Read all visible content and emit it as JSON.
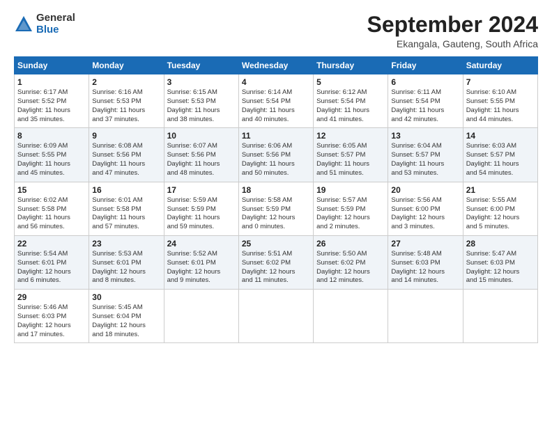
{
  "header": {
    "logo_general": "General",
    "logo_blue": "Blue",
    "month": "September 2024",
    "location": "Ekangala, Gauteng, South Africa"
  },
  "days_of_week": [
    "Sunday",
    "Monday",
    "Tuesday",
    "Wednesday",
    "Thursday",
    "Friday",
    "Saturday"
  ],
  "weeks": [
    [
      {
        "day": "1",
        "info": "Sunrise: 6:17 AM\nSunset: 5:52 PM\nDaylight: 11 hours\nand 35 minutes."
      },
      {
        "day": "2",
        "info": "Sunrise: 6:16 AM\nSunset: 5:53 PM\nDaylight: 11 hours\nand 37 minutes."
      },
      {
        "day": "3",
        "info": "Sunrise: 6:15 AM\nSunset: 5:53 PM\nDaylight: 11 hours\nand 38 minutes."
      },
      {
        "day": "4",
        "info": "Sunrise: 6:14 AM\nSunset: 5:54 PM\nDaylight: 11 hours\nand 40 minutes."
      },
      {
        "day": "5",
        "info": "Sunrise: 6:12 AM\nSunset: 5:54 PM\nDaylight: 11 hours\nand 41 minutes."
      },
      {
        "day": "6",
        "info": "Sunrise: 6:11 AM\nSunset: 5:54 PM\nDaylight: 11 hours\nand 42 minutes."
      },
      {
        "day": "7",
        "info": "Sunrise: 6:10 AM\nSunset: 5:55 PM\nDaylight: 11 hours\nand 44 minutes."
      }
    ],
    [
      {
        "day": "8",
        "info": "Sunrise: 6:09 AM\nSunset: 5:55 PM\nDaylight: 11 hours\nand 45 minutes."
      },
      {
        "day": "9",
        "info": "Sunrise: 6:08 AM\nSunset: 5:56 PM\nDaylight: 11 hours\nand 47 minutes."
      },
      {
        "day": "10",
        "info": "Sunrise: 6:07 AM\nSunset: 5:56 PM\nDaylight: 11 hours\nand 48 minutes."
      },
      {
        "day": "11",
        "info": "Sunrise: 6:06 AM\nSunset: 5:56 PM\nDaylight: 11 hours\nand 50 minutes."
      },
      {
        "day": "12",
        "info": "Sunrise: 6:05 AM\nSunset: 5:57 PM\nDaylight: 11 hours\nand 51 minutes."
      },
      {
        "day": "13",
        "info": "Sunrise: 6:04 AM\nSunset: 5:57 PM\nDaylight: 11 hours\nand 53 minutes."
      },
      {
        "day": "14",
        "info": "Sunrise: 6:03 AM\nSunset: 5:57 PM\nDaylight: 11 hours\nand 54 minutes."
      }
    ],
    [
      {
        "day": "15",
        "info": "Sunrise: 6:02 AM\nSunset: 5:58 PM\nDaylight: 11 hours\nand 56 minutes."
      },
      {
        "day": "16",
        "info": "Sunrise: 6:01 AM\nSunset: 5:58 PM\nDaylight: 11 hours\nand 57 minutes."
      },
      {
        "day": "17",
        "info": "Sunrise: 5:59 AM\nSunset: 5:59 PM\nDaylight: 11 hours\nand 59 minutes."
      },
      {
        "day": "18",
        "info": "Sunrise: 5:58 AM\nSunset: 5:59 PM\nDaylight: 12 hours\nand 0 minutes."
      },
      {
        "day": "19",
        "info": "Sunrise: 5:57 AM\nSunset: 5:59 PM\nDaylight: 12 hours\nand 2 minutes."
      },
      {
        "day": "20",
        "info": "Sunrise: 5:56 AM\nSunset: 6:00 PM\nDaylight: 12 hours\nand 3 minutes."
      },
      {
        "day": "21",
        "info": "Sunrise: 5:55 AM\nSunset: 6:00 PM\nDaylight: 12 hours\nand 5 minutes."
      }
    ],
    [
      {
        "day": "22",
        "info": "Sunrise: 5:54 AM\nSunset: 6:01 PM\nDaylight: 12 hours\nand 6 minutes."
      },
      {
        "day": "23",
        "info": "Sunrise: 5:53 AM\nSunset: 6:01 PM\nDaylight: 12 hours\nand 8 minutes."
      },
      {
        "day": "24",
        "info": "Sunrise: 5:52 AM\nSunset: 6:01 PM\nDaylight: 12 hours\nand 9 minutes."
      },
      {
        "day": "25",
        "info": "Sunrise: 5:51 AM\nSunset: 6:02 PM\nDaylight: 12 hours\nand 11 minutes."
      },
      {
        "day": "26",
        "info": "Sunrise: 5:50 AM\nSunset: 6:02 PM\nDaylight: 12 hours\nand 12 minutes."
      },
      {
        "day": "27",
        "info": "Sunrise: 5:48 AM\nSunset: 6:03 PM\nDaylight: 12 hours\nand 14 minutes."
      },
      {
        "day": "28",
        "info": "Sunrise: 5:47 AM\nSunset: 6:03 PM\nDaylight: 12 hours\nand 15 minutes."
      }
    ],
    [
      {
        "day": "29",
        "info": "Sunrise: 5:46 AM\nSunset: 6:03 PM\nDaylight: 12 hours\nand 17 minutes."
      },
      {
        "day": "30",
        "info": "Sunrise: 5:45 AM\nSunset: 6:04 PM\nDaylight: 12 hours\nand 18 minutes."
      },
      {
        "day": "",
        "info": ""
      },
      {
        "day": "",
        "info": ""
      },
      {
        "day": "",
        "info": ""
      },
      {
        "day": "",
        "info": ""
      },
      {
        "day": "",
        "info": ""
      }
    ]
  ]
}
